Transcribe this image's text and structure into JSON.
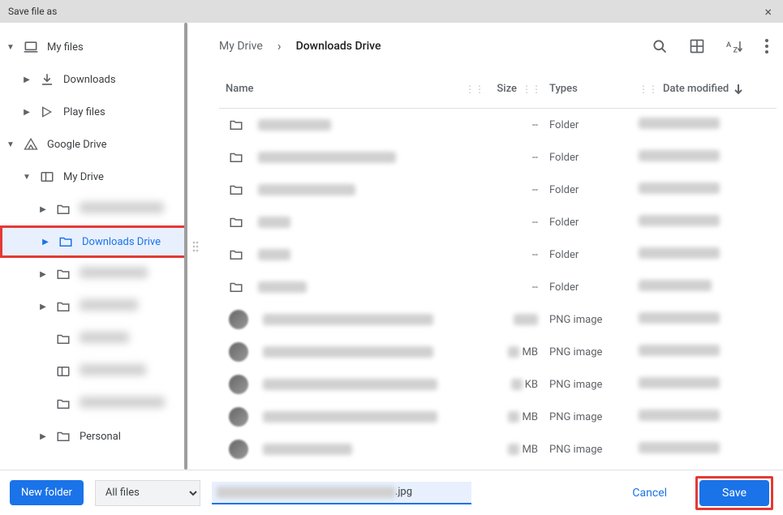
{
  "title_bar": {
    "title": "Save file as",
    "close": "×"
  },
  "sidebar": {
    "items": [
      {
        "label": "My files",
        "icon": "laptop",
        "indent": 0,
        "expanded": true
      },
      {
        "label": "Downloads",
        "icon": "download",
        "indent": 1,
        "expander": "right"
      },
      {
        "label": "Play files",
        "icon": "play",
        "indent": 1,
        "expander": "right"
      },
      {
        "label": "Google Drive",
        "icon": "drive",
        "indent": 0,
        "expanded": true
      },
      {
        "label": "My Drive",
        "icon": "panel",
        "indent": 1,
        "expanded": true
      },
      {
        "label": "redacted",
        "icon": "folder",
        "indent": 2,
        "expander": "right",
        "blurred": true
      },
      {
        "label": "Downloads Drive",
        "icon": "folder",
        "indent": 2,
        "expander": "right",
        "selected": true,
        "highlighted": true
      },
      {
        "label": "redacted",
        "icon": "folder",
        "indent": 2,
        "expander": "right",
        "blurred": true
      },
      {
        "label": "redacted",
        "icon": "folder",
        "indent": 2,
        "expander": "right",
        "blurred": true
      },
      {
        "label": "redacted",
        "icon": "folder",
        "indent": 2,
        "blurred": true
      },
      {
        "label": "redacted",
        "icon": "panel",
        "indent": 2,
        "blurred": true
      },
      {
        "label": "redacted",
        "icon": "folder",
        "indent": 2,
        "blurred": true
      },
      {
        "label": "Personal",
        "icon": "folder",
        "indent": 2,
        "expander": "right"
      }
    ]
  },
  "breadcrumb": {
    "root": "My Drive",
    "sep": "›",
    "current": "Downloads Drive"
  },
  "toolbar": {
    "search": "search",
    "view": "grid",
    "sort": "AZ",
    "more": "⋮"
  },
  "columns": {
    "name": "Name",
    "size": "Size",
    "types": "Types",
    "date": "Date modified"
  },
  "files": [
    {
      "name_blur": 90,
      "size": "--",
      "type": "Folder",
      "date_blur": 100,
      "icon": "folder"
    },
    {
      "name_blur": 170,
      "size": "--",
      "type": "Folder",
      "date_blur": 100,
      "icon": "folder"
    },
    {
      "name_blur": 120,
      "size": "--",
      "type": "Folder",
      "date_blur": 100,
      "icon": "folder"
    },
    {
      "name_blur": 40,
      "size": "--",
      "type": "Folder",
      "date_blur": 100,
      "icon": "folder"
    },
    {
      "name_blur": 40,
      "size": "--",
      "type": "Folder",
      "date_blur": 100,
      "icon": "folder"
    },
    {
      "name_blur": 60,
      "size": "--",
      "type": "Folder",
      "date_blur": 90,
      "icon": "folder"
    },
    {
      "name_blur": 210,
      "size_blur": 30,
      "size_suffix": "",
      "type": "PNG image",
      "date_blur": 100,
      "icon": "thumb"
    },
    {
      "name_blur": 210,
      "size_blur": 14,
      "size_suffix": "MB",
      "type": "PNG image",
      "date_blur": 100,
      "icon": "thumb"
    },
    {
      "name_blur": 215,
      "size_blur": 14,
      "size_suffix": "KB",
      "type": "PNG image",
      "date_blur": 100,
      "icon": "thumb"
    },
    {
      "name_blur": 215,
      "size_blur": 14,
      "size_suffix": "MB",
      "type": "PNG image",
      "date_blur": 100,
      "icon": "thumb"
    },
    {
      "name_blur": 110,
      "size_blur": 14,
      "size_suffix": "MB",
      "type": "PNG image",
      "date_blur": 100,
      "icon": "thumb"
    }
  ],
  "footer": {
    "new_folder": "New folder",
    "filetype": "All files",
    "filename_ext": ".jpg",
    "cancel": "Cancel",
    "save": "Save"
  }
}
